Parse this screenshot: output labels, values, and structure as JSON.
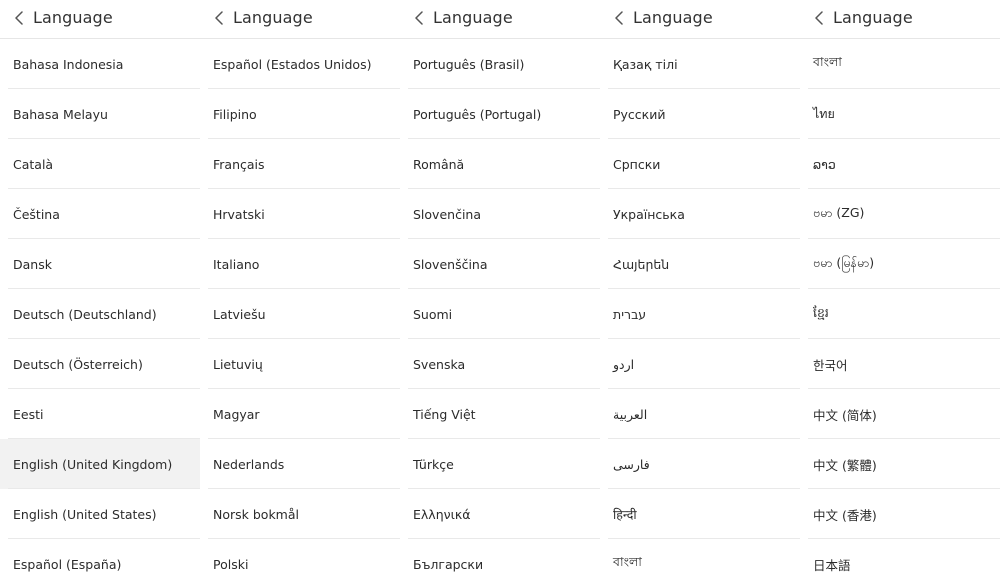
{
  "screens": [
    {
      "title": "Language",
      "back_icon": "chevron-left-icon",
      "items": [
        "Bahasa Indonesia",
        "Bahasa Melayu",
        "Català",
        "Čeština",
        "Dansk",
        "Deutsch (Deutschland)",
        "Deutsch (Österreich)",
        "Eesti",
        "English (United Kingdom)",
        "English (United States)",
        "Español (España)"
      ],
      "selected_index": 8
    },
    {
      "title": "Language",
      "back_icon": "chevron-left-icon",
      "items": [
        "Español (Estados Unidos)",
        "Filipino",
        "Français",
        "Hrvatski",
        "Italiano",
        "Latviešu",
        "Lietuvių",
        "Magyar",
        "Nederlands",
        "Norsk bokmål",
        "Polski"
      ],
      "selected_index": -1
    },
    {
      "title": "Language",
      "back_icon": "chevron-left-icon",
      "items": [
        "Português (Brasil)",
        "Português (Portugal)",
        "Română",
        "Slovenčina",
        "Slovenščina",
        "Suomi",
        "Svenska",
        "Tiếng Việt",
        "Türkçe",
        "Ελληνικά",
        "Български"
      ],
      "selected_index": -1
    },
    {
      "title": "Language",
      "back_icon": "chevron-left-icon",
      "items": [
        "Қазақ тілі",
        "Русский",
        "Српски",
        "Українська",
        "Հայերեն",
        "עברית",
        "اردو",
        "العربية",
        "فارسی",
        "हिन्दी",
        "বাংলা"
      ],
      "selected_index": -1
    },
    {
      "title": "Language",
      "back_icon": "chevron-left-icon",
      "items": [
        "বাংলা",
        "ไทย",
        "ລາວ",
        "ဗမာ (ZG)",
        "ဗမာ (မြန်မာ)",
        "ខ្មែរ",
        "한국어",
        "中文 (简体)",
        "中文 (繁體)",
        "中文 (香港)",
        "日本語"
      ],
      "selected_index": -1
    }
  ],
  "colors": {
    "background": "#ffffff",
    "divider": "#e9e9e9",
    "selected_row": "#f2f2f2",
    "text": "#2b2b2b"
  }
}
